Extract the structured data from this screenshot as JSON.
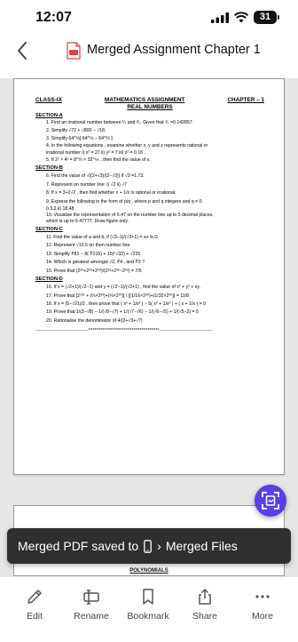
{
  "status": {
    "time": "12:07",
    "battery": "31"
  },
  "header": {
    "title": "Merged Assignment Chapter 1"
  },
  "doc": {
    "class": "CLASS-IX",
    "subject": "MATHEMATICS ASSIGNMENT",
    "chapter": "CHAPTER – 1",
    "topic": "REAL NUMBERS",
    "section_a": "SECTION-A",
    "section_b": "SECTION-B",
    "section_c": "SECTION-C",
    "section_d": "SECTION-D",
    "questions": {
      "q1": "1. Find an irrational number between ¹⁄₇ and ²⁄₇. Given that ¹⁄₇ =0.142857.",
      "q2": "2. Simplify √72 + √800 − √18.",
      "q3": "3. Simplify 64^⅓[ 64^⅓ − 64^⅔ ]",
      "q4": "4. In the following equations , examine whether x, y and z represents rational or",
      "q4b": "irrational number    i) x² = 27        ii) y² = 7        iii) z² = 0.16 .",
      "q5": "5. If 2ˣ × 4ˣ = 8^⅓ × 32^⅕ , then find the value of x.",
      "q6": "6. Find the value of √((2+√3)/(2−√3)) if √3 =1.73.",
      "q7": "7. Represent  on number line: i) √2        ii) √7",
      "q8": "8. If  x = 3+2√2 , then find whether x + 1/x is rational or irrational.",
      "q9": "9. Express  the following in the form of p/q , where p and q  integers  and q ≠ 0:",
      "q9b": "i) 3.2̅          ii)  18.4̅8̅",
      "q10": "10. Visualise the representation of 6.47 on the number line up to 5 decimal places,",
      "q10b": "which is up to 6.47777. Draw figure only.",
      "q11": "11. Find the value of a and b, if (√3−1)/(√3+1) = a+ b√3",
      "q12": "12. Represent √10.5 on then number line.",
      "q13": "13. Simplify ∜81 − 8( ∛216) + 15(⁵√32) + √225.",
      "q14": "14. Which is greatest amongst √2, ∜4 , and ∛3 ?",
      "q15": "15. Prove that (2³⁰+2²⁹+2²⁸)/(2³¹+2³⁰−2²⁹) = 7/5",
      "q16": "16. If x = (√2+1)/(√2−1) and y = (√2−1)/(√2+1) , find the value of x² + y² + xy.",
      "q17": "17. Prove that [2¹³⁶ + (⅓×2³³)+(⅓×2³⁷)] / [(1/16×2³⁹)+(1/32×2³⁰)] = 11/8",
      "q18": "18. If x = (5−√21)/2 , then prove that ( x³ + 1/x³ ) − 5( x² + 1/x² ) + ( x + 1/x ) = 0",
      "q19": "19. Prove that 1/(3−√8) − 1/(√8−√7) + 1/(√7−√6) − 1/(√6−√5) + 1/(√5−2) = 5",
      "q20": "20. Rationalise the denominator of 4/(2+√3+√7)",
      "end": "-------------------------------************************************-------------------------------"
    },
    "page2_title": "POLYNOMIALS"
  },
  "snackbar": {
    "prefix": "Merged PDF saved to",
    "suffix": "Merged Files"
  },
  "bottom_nav": {
    "edit": "Edit",
    "rename": "Rename",
    "bookmark": "Bookmark",
    "share": "Share",
    "more": "More"
  }
}
